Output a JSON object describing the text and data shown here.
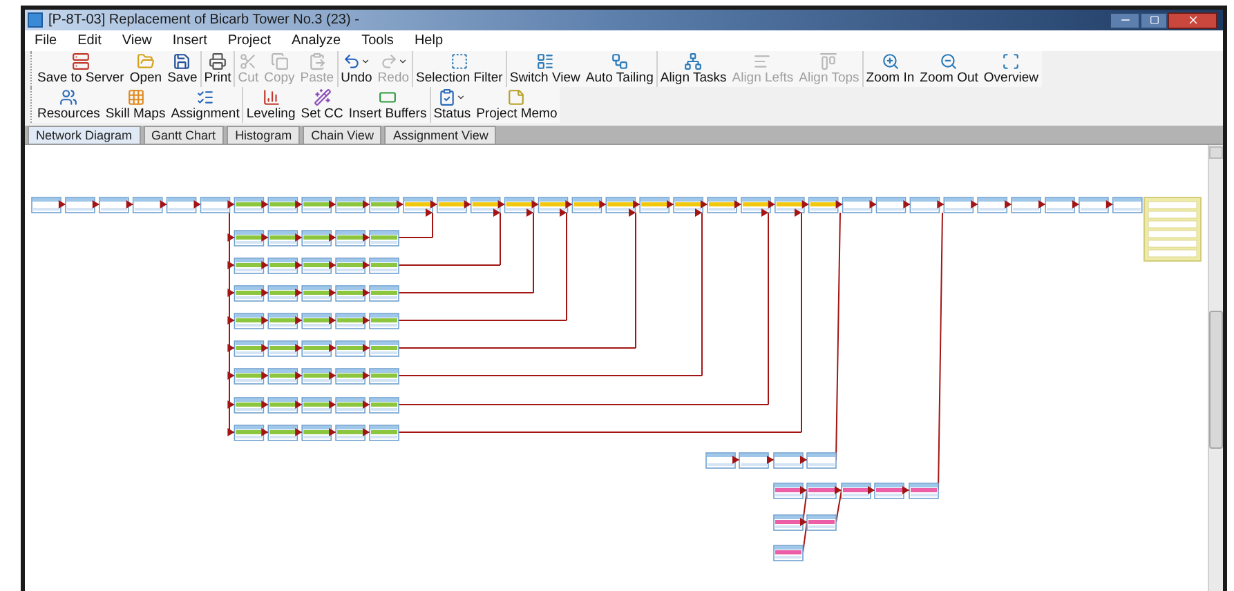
{
  "window": {
    "title": "[P-8T-03] Replacement of Bicarb Tower No.3 (23) -"
  },
  "menu": [
    "File",
    "Edit",
    "View",
    "Insert",
    "Project",
    "Analyze",
    "Tools",
    "Help"
  ],
  "toolbars": [
    {
      "groups": [
        {
          "buttons": [
            {
              "label": "Save to Server",
              "disabled": false,
              "has_menu": false
            },
            {
              "label": "Open",
              "disabled": false,
              "has_menu": false
            },
            {
              "label": "Save",
              "disabled": false,
              "has_menu": false
            }
          ]
        },
        {
          "buttons": [
            {
              "label": "Print",
              "disabled": false,
              "has_menu": false
            }
          ]
        },
        {
          "buttons": [
            {
              "label": "Cut",
              "disabled": true,
              "has_menu": false
            },
            {
              "label": "Copy",
              "disabled": true,
              "has_menu": false
            },
            {
              "label": "Paste",
              "disabled": true,
              "has_menu": false
            }
          ]
        },
        {
          "buttons": [
            {
              "label": "Undo",
              "disabled": false,
              "has_menu": true
            },
            {
              "label": "Redo",
              "disabled": true,
              "has_menu": true
            }
          ]
        },
        {
          "buttons": [
            {
              "label": "Selection Filter",
              "disabled": false,
              "has_menu": false
            }
          ]
        },
        {
          "buttons": [
            {
              "label": "Switch View",
              "disabled": false,
              "has_menu": false
            },
            {
              "label": "Auto Tailing",
              "disabled": false,
              "has_menu": false
            }
          ]
        },
        {
          "buttons": [
            {
              "label": "Align Tasks",
              "disabled": false,
              "has_menu": false
            },
            {
              "label": "Align Lefts",
              "disabled": true,
              "has_menu": false
            },
            {
              "label": "Align Tops",
              "disabled": true,
              "has_menu": false
            }
          ]
        },
        {
          "buttons": [
            {
              "label": "Zoom In",
              "disabled": false,
              "has_menu": false
            },
            {
              "label": "Zoom Out",
              "disabled": false,
              "has_menu": false
            },
            {
              "label": "Overview",
              "disabled": false,
              "has_menu": false
            }
          ]
        }
      ]
    },
    {
      "groups": [
        {
          "buttons": [
            {
              "label": "Resources",
              "disabled": false,
              "has_menu": false
            },
            {
              "label": "Skill Maps",
              "disabled": false,
              "has_menu": false
            },
            {
              "label": "Assignment",
              "disabled": false,
              "has_menu": false
            }
          ]
        },
        {
          "buttons": [
            {
              "label": "Leveling",
              "disabled": false,
              "has_menu": false
            },
            {
              "label": "Set CC",
              "disabled": false,
              "has_menu": false
            },
            {
              "label": "Insert Buffers",
              "disabled": false,
              "has_menu": false
            }
          ]
        },
        {
          "buttons": [
            {
              "label": "Status",
              "disabled": false,
              "has_menu": true
            },
            {
              "label": "Project Memo",
              "disabled": false,
              "has_menu": false
            }
          ]
        }
      ]
    }
  ],
  "tabs": [
    {
      "label": "Network Diagram",
      "selected": true
    },
    {
      "label": "Gantt Chart",
      "selected": false
    },
    {
      "label": "Histogram",
      "selected": false
    },
    {
      "label": "Chain View",
      "selected": false
    },
    {
      "label": "Assignment View",
      "selected": false
    }
  ]
}
